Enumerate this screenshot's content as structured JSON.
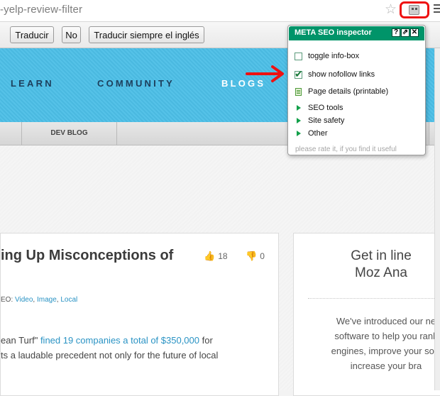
{
  "browser": {
    "url_fragment": "-yelp-review-filter",
    "star_icon": "star-icon",
    "extension_icon": "meta-seo-extension-icon",
    "menu_icon": "menu-icon",
    "highlight_color": "#ee1111"
  },
  "translate_bar": {
    "translate_label": "Traducir",
    "no_label": "No",
    "always_label": "Traducir siempre el inglés"
  },
  "nav": {
    "items": [
      {
        "label": "LEARN"
      },
      {
        "label": "COMMUNITY"
      },
      {
        "label": "BLOGS"
      }
    ],
    "band_color": "#4cbfe7"
  },
  "subnav": {
    "items": [
      {
        "label": "DEV BLOG"
      }
    ]
  },
  "post": {
    "title_fragment": "ing Up Misconceptions of",
    "upvotes": "18",
    "downvotes": "0",
    "category_prefix": "EO: ",
    "categories": [
      "Video",
      "Image",
      "Local"
    ],
    "category_sep1": ", ",
    "category_sep2": ", ",
    "excerpt_line1_pre": "ean Turf\" ",
    "excerpt_line1_link": "fined 19 companies a total of $350,000",
    "excerpt_line1_post": " for",
    "excerpt_line2": "ts a laudable precedent not only for the future of local",
    "link_color": "#2a93c4"
  },
  "promo": {
    "title_line1": "Get in line",
    "title_line2": "Moz Ana",
    "text_line1": "We've introduced our ne",
    "text_line2": "software to help you rank",
    "text_line3": "engines, improve your soci",
    "text_line4": "increase your bra"
  },
  "popup": {
    "title": "META SEO inspector",
    "help_label": "?",
    "popout_label": "⇗",
    "close_label": "✕",
    "header_color": "#009469",
    "items": [
      {
        "label": "toggle info-box",
        "type": "checkbox",
        "checked": false
      },
      {
        "label": "show nofollow links",
        "type": "checkbox",
        "checked": true
      },
      {
        "label": "Page details (printable)",
        "type": "document"
      },
      {
        "label": "SEO tools",
        "type": "expander"
      },
      {
        "label": "Site safety",
        "type": "expander"
      },
      {
        "label": "Other",
        "type": "expander"
      }
    ],
    "footer": "please rate it, if you find it useful"
  },
  "annotation": {
    "arrow_color": "#ee1111"
  }
}
